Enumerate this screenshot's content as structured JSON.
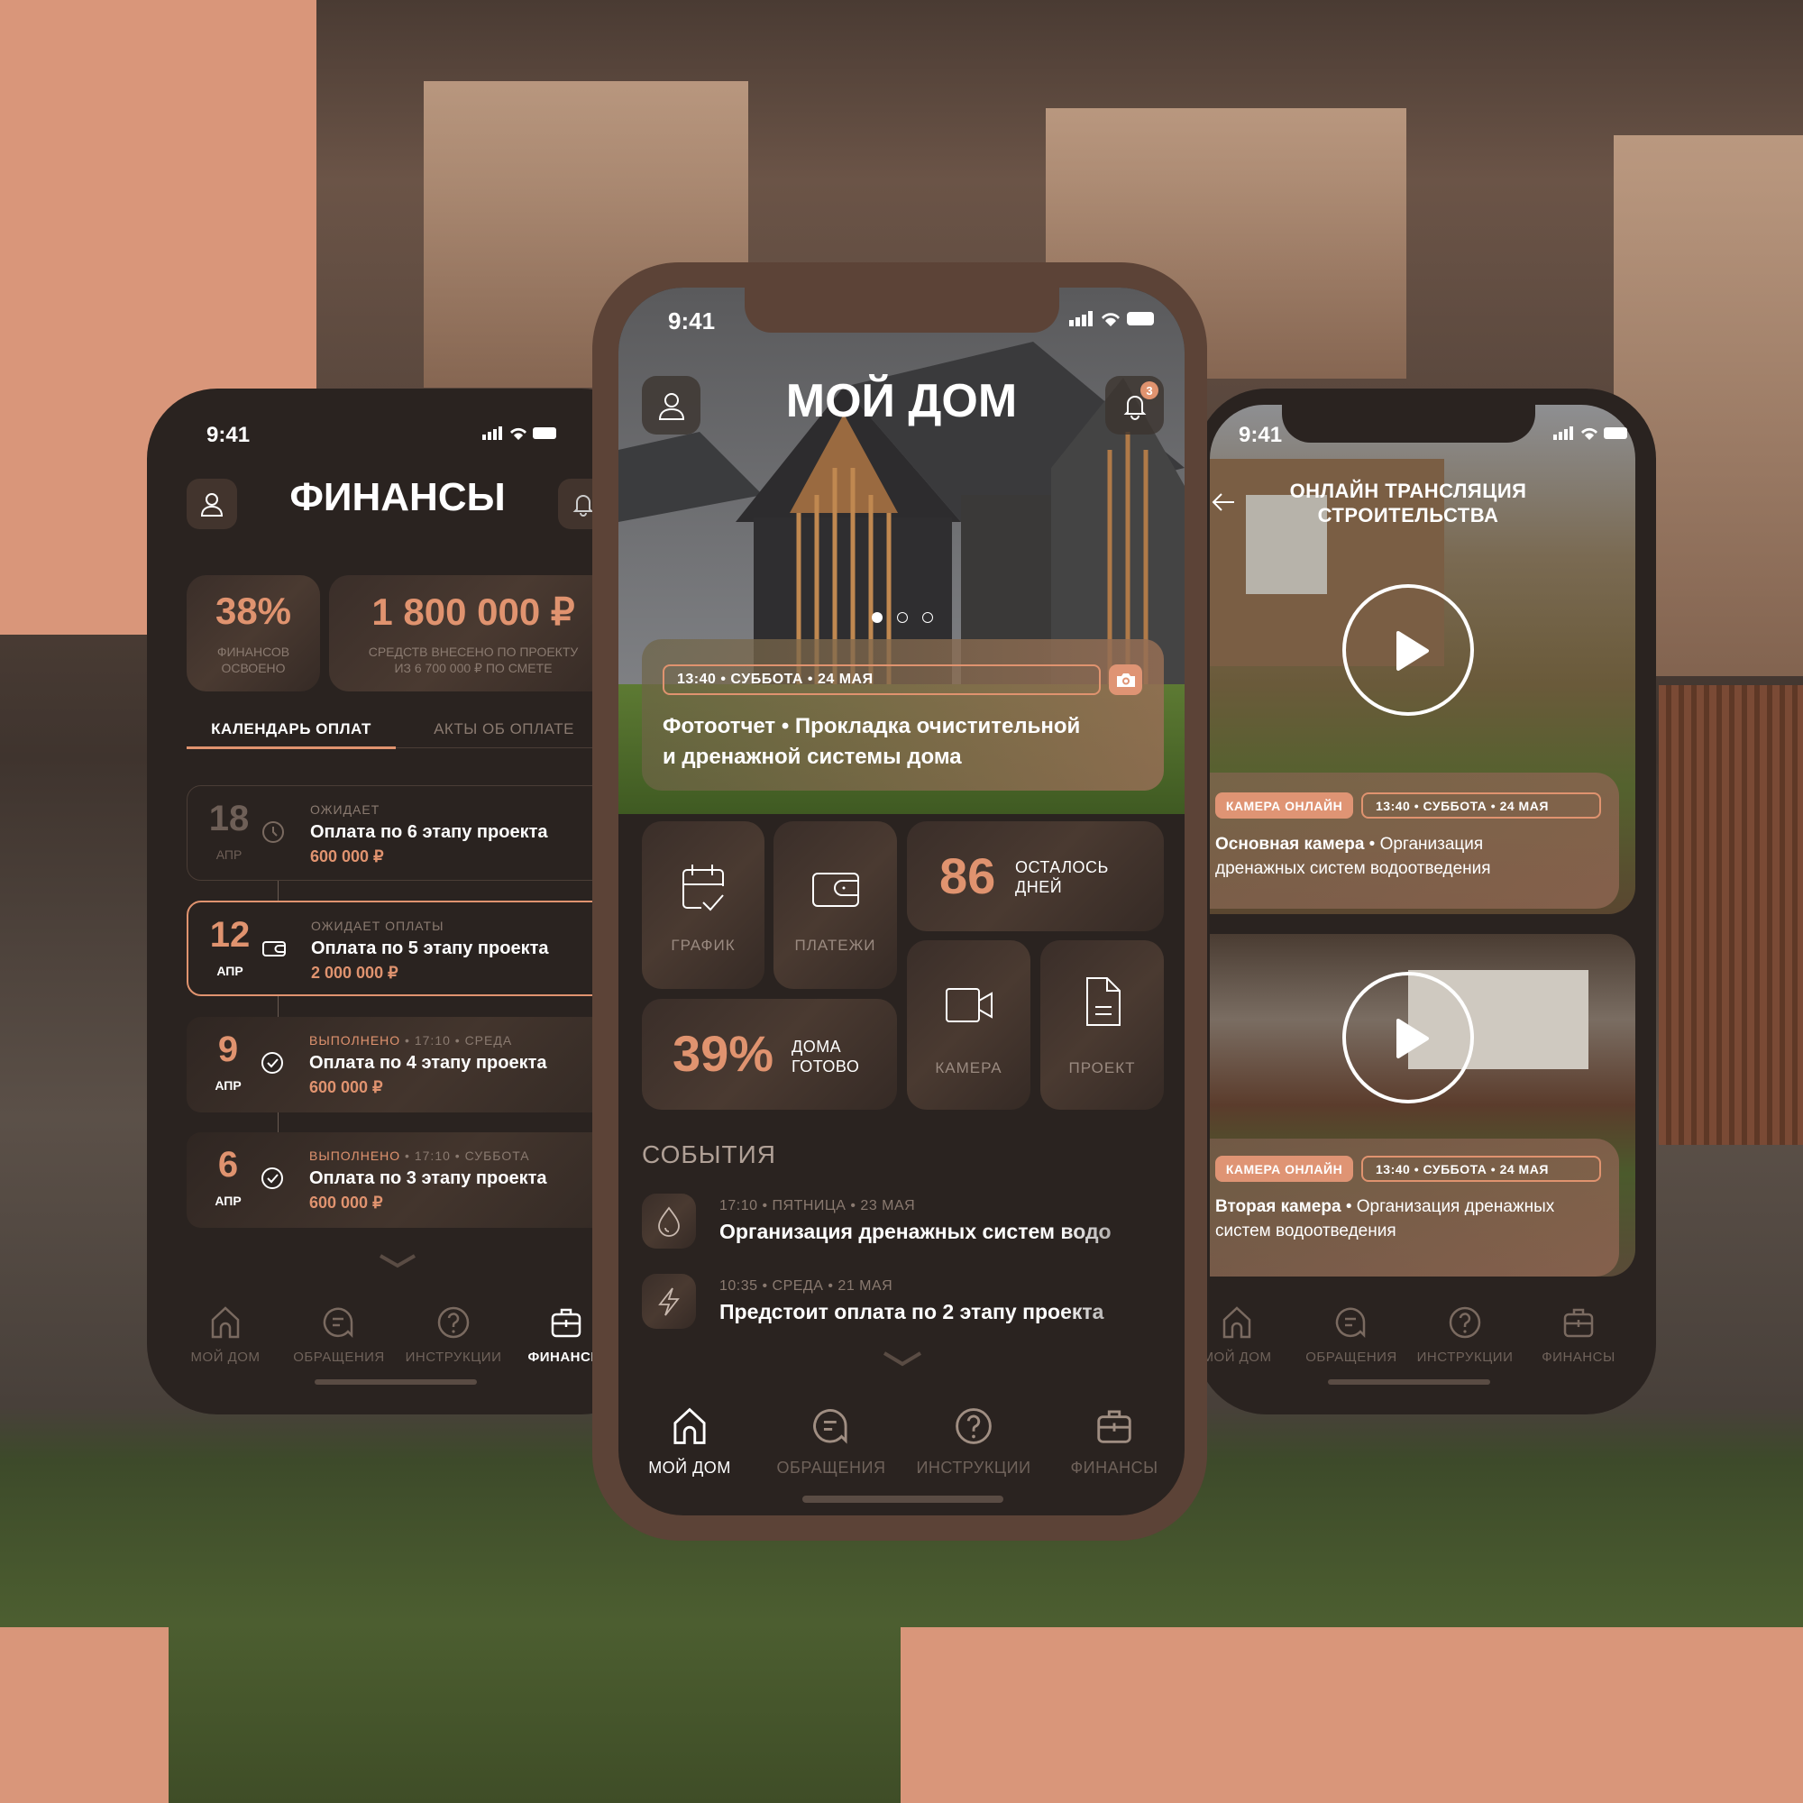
{
  "colors": {
    "accent": "#e0936f",
    "background": "#2a2320",
    "bezel": "#5c4337",
    "salmon": "#d9967a"
  },
  "status": {
    "time": "9:41",
    "icons": [
      "signal-icon",
      "wifi-icon",
      "battery-icon"
    ]
  },
  "finance_screen": {
    "title": "ФИНАНСЫ",
    "stats": [
      {
        "value": "38%",
        "label_1": "ФИНАНСОВ",
        "label_2": "ОСВОЕНО"
      },
      {
        "value": "1 800 000 ₽",
        "label_1": "СРЕДСТВ ВНЕСЕНО ПО ПРОЕКТУ",
        "label_2": "ИЗ 6 700 000 ₽ ПО СМЕТЕ"
      }
    ],
    "tabs": [
      {
        "label": "КАЛЕНДАРЬ ОПЛАТ",
        "active": true
      },
      {
        "label": "АКТЫ ОБ ОПЛАТЕ",
        "active": false
      }
    ],
    "payments": [
      {
        "day": "18",
        "month": "АПР",
        "status": "ОЖИДАЕТ",
        "status_extra": "",
        "title": "Оплата по 6 этапу проекта",
        "amount": "600 000 ₽",
        "icon": "clock-icon"
      },
      {
        "day": "12",
        "month": "АПР",
        "status": "ОЖИДАЕТ ОПЛАТЫ",
        "status_extra": "",
        "title": "Оплата по 5 этапу проекта",
        "amount": "2 000 000 ₽",
        "icon": "wallet-icon",
        "highlighted": true
      },
      {
        "day": "9",
        "month": "АПР",
        "status": "ВЫПОЛНЕНО",
        "status_extra": " • 17:10 • СРЕДА",
        "title": "Оплата по 4 этапу проекта",
        "amount": "600 000 ₽",
        "icon": "check-circle-icon"
      },
      {
        "day": "6",
        "month": "АПР",
        "status": "ВЫПОЛНЕНО",
        "status_extra": " • 17:10 • СУББОТА",
        "title": "Оплата по 3 этапу проекта",
        "amount": "600 000 ₽",
        "icon": "check-circle-icon"
      }
    ]
  },
  "home_screen": {
    "title": "МОЙ ДОМ",
    "notification_count": "3",
    "carousel": {
      "pages": 3,
      "active": 1
    },
    "photo_report": {
      "date": "13:40 • СУББОТА • 24 МАЯ",
      "title_1": "Фотоотчет • Прокладка очистительной",
      "title_2": "и дренажной системы дома"
    },
    "tiles": {
      "schedule": "ГРАФИК",
      "payments": "ПЛАТЕЖИ",
      "days_value": "86",
      "days_label_1": "ОСТАЛОСЬ",
      "days_label_2": "ДНЕЙ",
      "ready_value": "39%",
      "ready_label_1": "ДОМА",
      "ready_label_2": "ГОТОВО",
      "camera": "КАМЕРА",
      "project": "ПРОЕКТ"
    },
    "events_title": "СОБЫТИЯ",
    "events": [
      {
        "date": "17:10 • ПЯТНИЦА • 23 МАЯ",
        "title": "Организация дренажных систем водо",
        "icon": "drop-icon"
      },
      {
        "date": "10:35 • СРЕДА • 21 МАЯ",
        "title": "Предстоит оплата по 2 этапу проекта",
        "icon": "lightning-icon"
      }
    ]
  },
  "camera_screen": {
    "title_1": "ОНЛАЙН ТРАНСЛЯЦИЯ",
    "title_2": "СТРОИТЕЛЬСТВА",
    "cameras": [
      {
        "badge": "КАМЕРА ОНЛАЙН",
        "date": "13:40 • СУББОТА • 24 МАЯ",
        "name": "Основная камера",
        "desc_1": " • Организация",
        "desc_2": "дренажных систем водоотведения"
      },
      {
        "badge": "КАМЕРА ОНЛАЙН",
        "date": "13:40 • СУББОТА • 24 МАЯ",
        "name": "Вторая камера",
        "desc_1": " • Организация дренажных",
        "desc_2": "систем водоотведения"
      }
    ]
  },
  "nav": [
    {
      "label": "МОЙ ДОМ",
      "icon": "home-icon"
    },
    {
      "label": "ОБРАЩЕНИЯ",
      "icon": "chat-icon"
    },
    {
      "label": "ИНСТРУКЦИИ",
      "icon": "question-icon"
    },
    {
      "label": "ФИНАНСЫ",
      "icon": "briefcase-icon"
    }
  ]
}
